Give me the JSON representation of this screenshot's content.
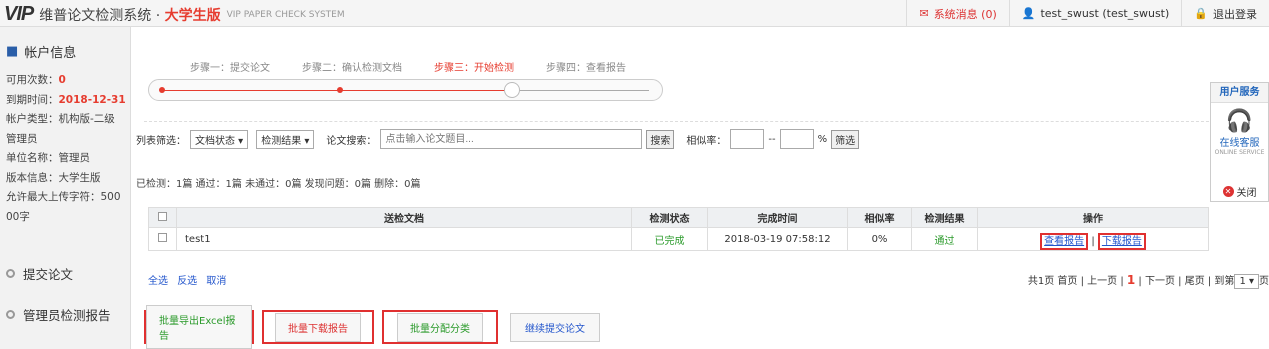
{
  "header": {
    "logo_text": "VIP",
    "app_title": "维普论文检测系统 · ",
    "edition": "大学生版",
    "subtitle": "VIP PAPER CHECK SYSTEM",
    "messages": "系统消息 (0)",
    "user": "test_swust (test_swust)",
    "logout": "退出登录"
  },
  "sidebar": {
    "account_title": "帐户信息",
    "available_label": "可用次数：",
    "available_value": "0",
    "expire_label": "到期时间：",
    "expire_value": "2018-12-31",
    "type_line1": "帐户类型：机构版-二级",
    "type_line2": "管理员",
    "unit": "单位名称：管理员",
    "version": "版本信息：大学生版",
    "max_line1": "允许最大上传字符：500",
    "max_line2": "00字",
    "nav_submit": "提交论文",
    "nav_admin": "管理员检测报告"
  },
  "steps": [
    "步骤一：提交论文",
    "步骤二：确认检测文档",
    "步骤三：开始检测",
    "步骤四：查看报告"
  ],
  "filter": {
    "label": "列表筛选：",
    "doc_status": "文档状态 ▾",
    "result": "检测结果 ▾",
    "search_label": "论文搜索：",
    "search_placeholder": "点击输入论文题目...",
    "search_btn": "搜索",
    "sim_label": "相似率：",
    "dash": "--",
    "percent": "%",
    "filter_btn": "筛选"
  },
  "stats": "已检测：1篇 通过：1篇 未通过：0篇 发现问题：0篇 删除：0篇",
  "table": {
    "headers": [
      "送检文档",
      "检测状态",
      "完成时间",
      "相似率",
      "检测结果",
      "操作"
    ],
    "row": {
      "doc": "test1",
      "status": "已完成",
      "time": "2018-03-19 07:58:12",
      "sim": "0%",
      "result": "通过",
      "view": "查看报告",
      "sep": "|",
      "download": "下载报告"
    }
  },
  "select_links": [
    "全选",
    "反选",
    "取消"
  ],
  "pager": {
    "prefix": "共1页  首页 | 上一页 | ",
    "current": "1",
    "suffix": " | 下一页 | 尾页 | 到第",
    "page_sel": "1 ▾",
    "end": "页"
  },
  "buttons": {
    "export_excel": "批量导出Excel报告",
    "batch_download": "批量下载报告",
    "batch_assign": "批量分配分类",
    "continue_submit": "继续提交论文"
  },
  "service": {
    "title": "用户服务",
    "online": "在线客服",
    "online_en": "ONLINE SERVICE",
    "close": "关闭"
  }
}
